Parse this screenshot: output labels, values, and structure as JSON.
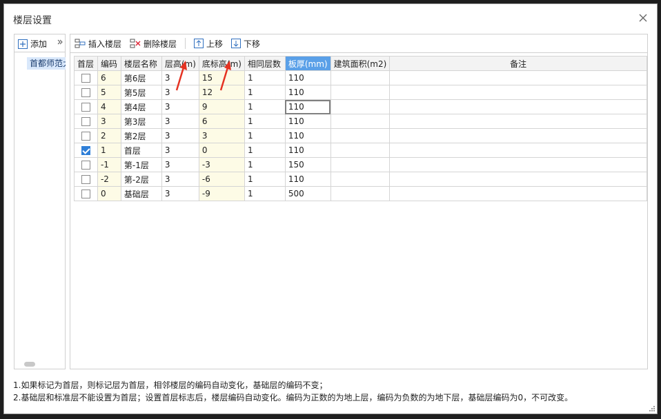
{
  "dialog": {
    "title": "楼层设置"
  },
  "left_panel": {
    "add_label": "添加",
    "tree_item": "首都师范大"
  },
  "toolbar": {
    "insert": "插入楼层",
    "delete": "删除楼层",
    "up": "上移",
    "down": "下移"
  },
  "table": {
    "headers": [
      "首层",
      "编码",
      "楼层名称",
      "层高(m)",
      "底标高(m)",
      "相同层数",
      "板厚(mm)",
      "建筑面积(m2)",
      "备注"
    ],
    "rows": [
      {
        "first": false,
        "code": "6",
        "name": "第6层",
        "height": "3",
        "elev": "15",
        "same": "1",
        "thick": "110",
        "area": "",
        "note": ""
      },
      {
        "first": false,
        "code": "5",
        "name": "第5层",
        "height": "3",
        "elev": "12",
        "same": "1",
        "thick": "110",
        "area": "",
        "note": ""
      },
      {
        "first": false,
        "code": "4",
        "name": "第4层",
        "height": "3",
        "elev": "9",
        "same": "1",
        "thick": "110",
        "area": "",
        "note": ""
      },
      {
        "first": false,
        "code": "3",
        "name": "第3层",
        "height": "3",
        "elev": "6",
        "same": "1",
        "thick": "110",
        "area": "",
        "note": ""
      },
      {
        "first": false,
        "code": "2",
        "name": "第2层",
        "height": "3",
        "elev": "3",
        "same": "1",
        "thick": "110",
        "area": "",
        "note": ""
      },
      {
        "first": true,
        "code": "1",
        "name": "首层",
        "height": "3",
        "elev": "0",
        "same": "1",
        "thick": "110",
        "area": "",
        "note": ""
      },
      {
        "first": false,
        "code": "-1",
        "name": "第-1层",
        "height": "3",
        "elev": "-3",
        "same": "1",
        "thick": "150",
        "area": "",
        "note": ""
      },
      {
        "first": false,
        "code": "-2",
        "name": "第-2层",
        "height": "3",
        "elev": "-6",
        "same": "1",
        "thick": "110",
        "area": "",
        "note": ""
      },
      {
        "first": false,
        "code": "0",
        "name": "基础层",
        "height": "3",
        "elev": "-9",
        "same": "1",
        "thick": "500",
        "area": "",
        "note": ""
      }
    ]
  },
  "notes": [
    "1.如果标记为首层，则标记层为首层，相邻楼层的编码自动变化，基础层的编码不变；",
    "2.基础层和标准层不能设置为首层；设置首层标志后，楼层编码自动变化。编码为正数的为地上层，编码为负数的为地下层，基础层编码为0，不可改变。"
  ],
  "colors": {
    "selected_header": "#5aa0e8",
    "checkbox_on": "#2f7fd8",
    "annotation_arrow": "#e53222"
  }
}
